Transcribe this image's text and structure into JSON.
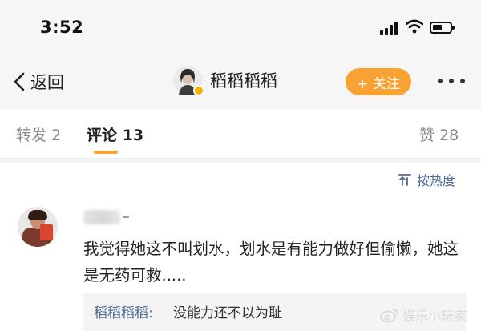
{
  "status_bar": {
    "time": "3:52",
    "icons": [
      "signal-icon",
      "wifi-icon",
      "battery-icon"
    ]
  },
  "nav": {
    "back_label": "返回",
    "profile_name": "稻稻稻稻",
    "follow_label": "+ 关注",
    "more_icon": "more-dots-icon",
    "accent_color": "#f7a233"
  },
  "tabs": [
    {
      "label": "转发 2"
    },
    {
      "label": "评论 13"
    },
    {
      "label": "赞 28"
    }
  ],
  "sort": {
    "label": "按热度",
    "icon": "sort-icon"
  },
  "comment": {
    "username_suffix": "_",
    "text": "我觉得她这不叫划水，划水是有能力做好但偷懒，她这是无药可救.....",
    "reply": {
      "author": "稻稻稻稻:",
      "text": "没能力还不以为耻"
    }
  },
  "watermark": {
    "label": "娱乐小玩家",
    "icon": "weibo-logo-icon"
  }
}
